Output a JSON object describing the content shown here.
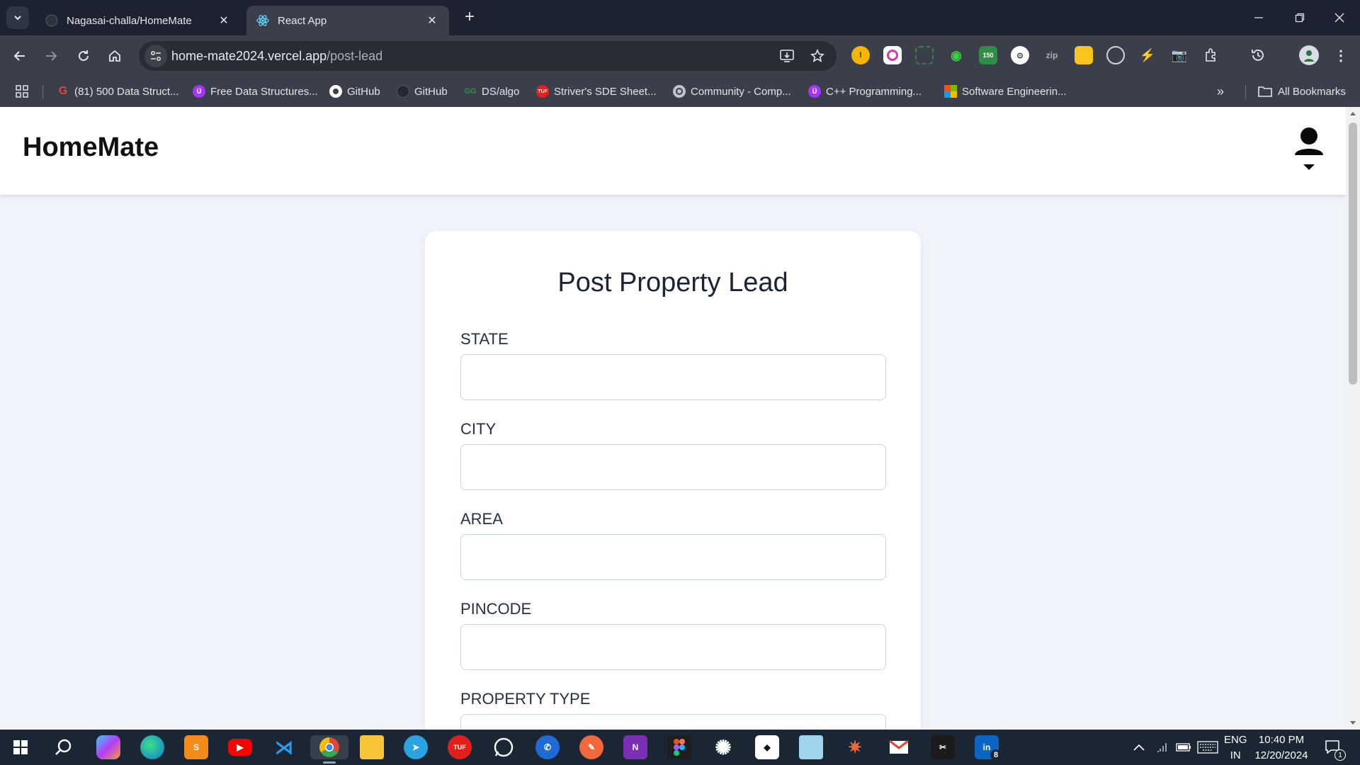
{
  "browser": {
    "tabs": [
      {
        "title": "Nagasai-challa/HomeMate",
        "favicon": "github-icon"
      },
      {
        "title": "React App",
        "favicon": "react-icon"
      }
    ],
    "url": {
      "host": "home-mate2024.vercel.app",
      "path": "/post-lead"
    },
    "bookmarks": [
      {
        "label": "(81) 500 Data Struct...",
        "icon": "g-icon",
        "color": "#e2453c"
      },
      {
        "label": "Free Data Structures...",
        "icon": "u-icon",
        "color": "#a435f0"
      },
      {
        "label": "GitHub",
        "icon": "github-icon",
        "color": "#ffffff"
      },
      {
        "label": "GitHub",
        "icon": "github-icon",
        "color": "#24292f"
      },
      {
        "label": "DS/algo",
        "icon": "gfg-icon",
        "color": "#2f8d46"
      },
      {
        "label": "Striver's SDE Sheet...",
        "icon": "tuf-icon",
        "color": "#e0201b"
      },
      {
        "label": "Community - Comp...",
        "icon": "globe-icon",
        "color": "#bfc4cc"
      },
      {
        "label": "C++ Programming...",
        "icon": "u-icon",
        "color": "#a435f0"
      },
      {
        "label": "Software Engineerin...",
        "icon": "microsoft-icon",
        "color": "#f25022"
      }
    ],
    "all_bookmarks_label": "All Bookmarks"
  },
  "app": {
    "brand": "HomeMate",
    "form": {
      "title": "Post Property Lead",
      "fields": [
        {
          "label": "STATE",
          "value": ""
        },
        {
          "label": "CITY",
          "value": ""
        },
        {
          "label": "AREA",
          "value": ""
        },
        {
          "label": "PINCODE",
          "value": ""
        },
        {
          "label": "PROPERTY TYPE",
          "value": ""
        }
      ]
    }
  },
  "taskbar": {
    "language": "ENG",
    "region": "IN",
    "time": "10:40 PM",
    "date": "12/20/2024",
    "linkedin_badge": "8",
    "leetcode_badge": "150",
    "notification_count": "1"
  }
}
